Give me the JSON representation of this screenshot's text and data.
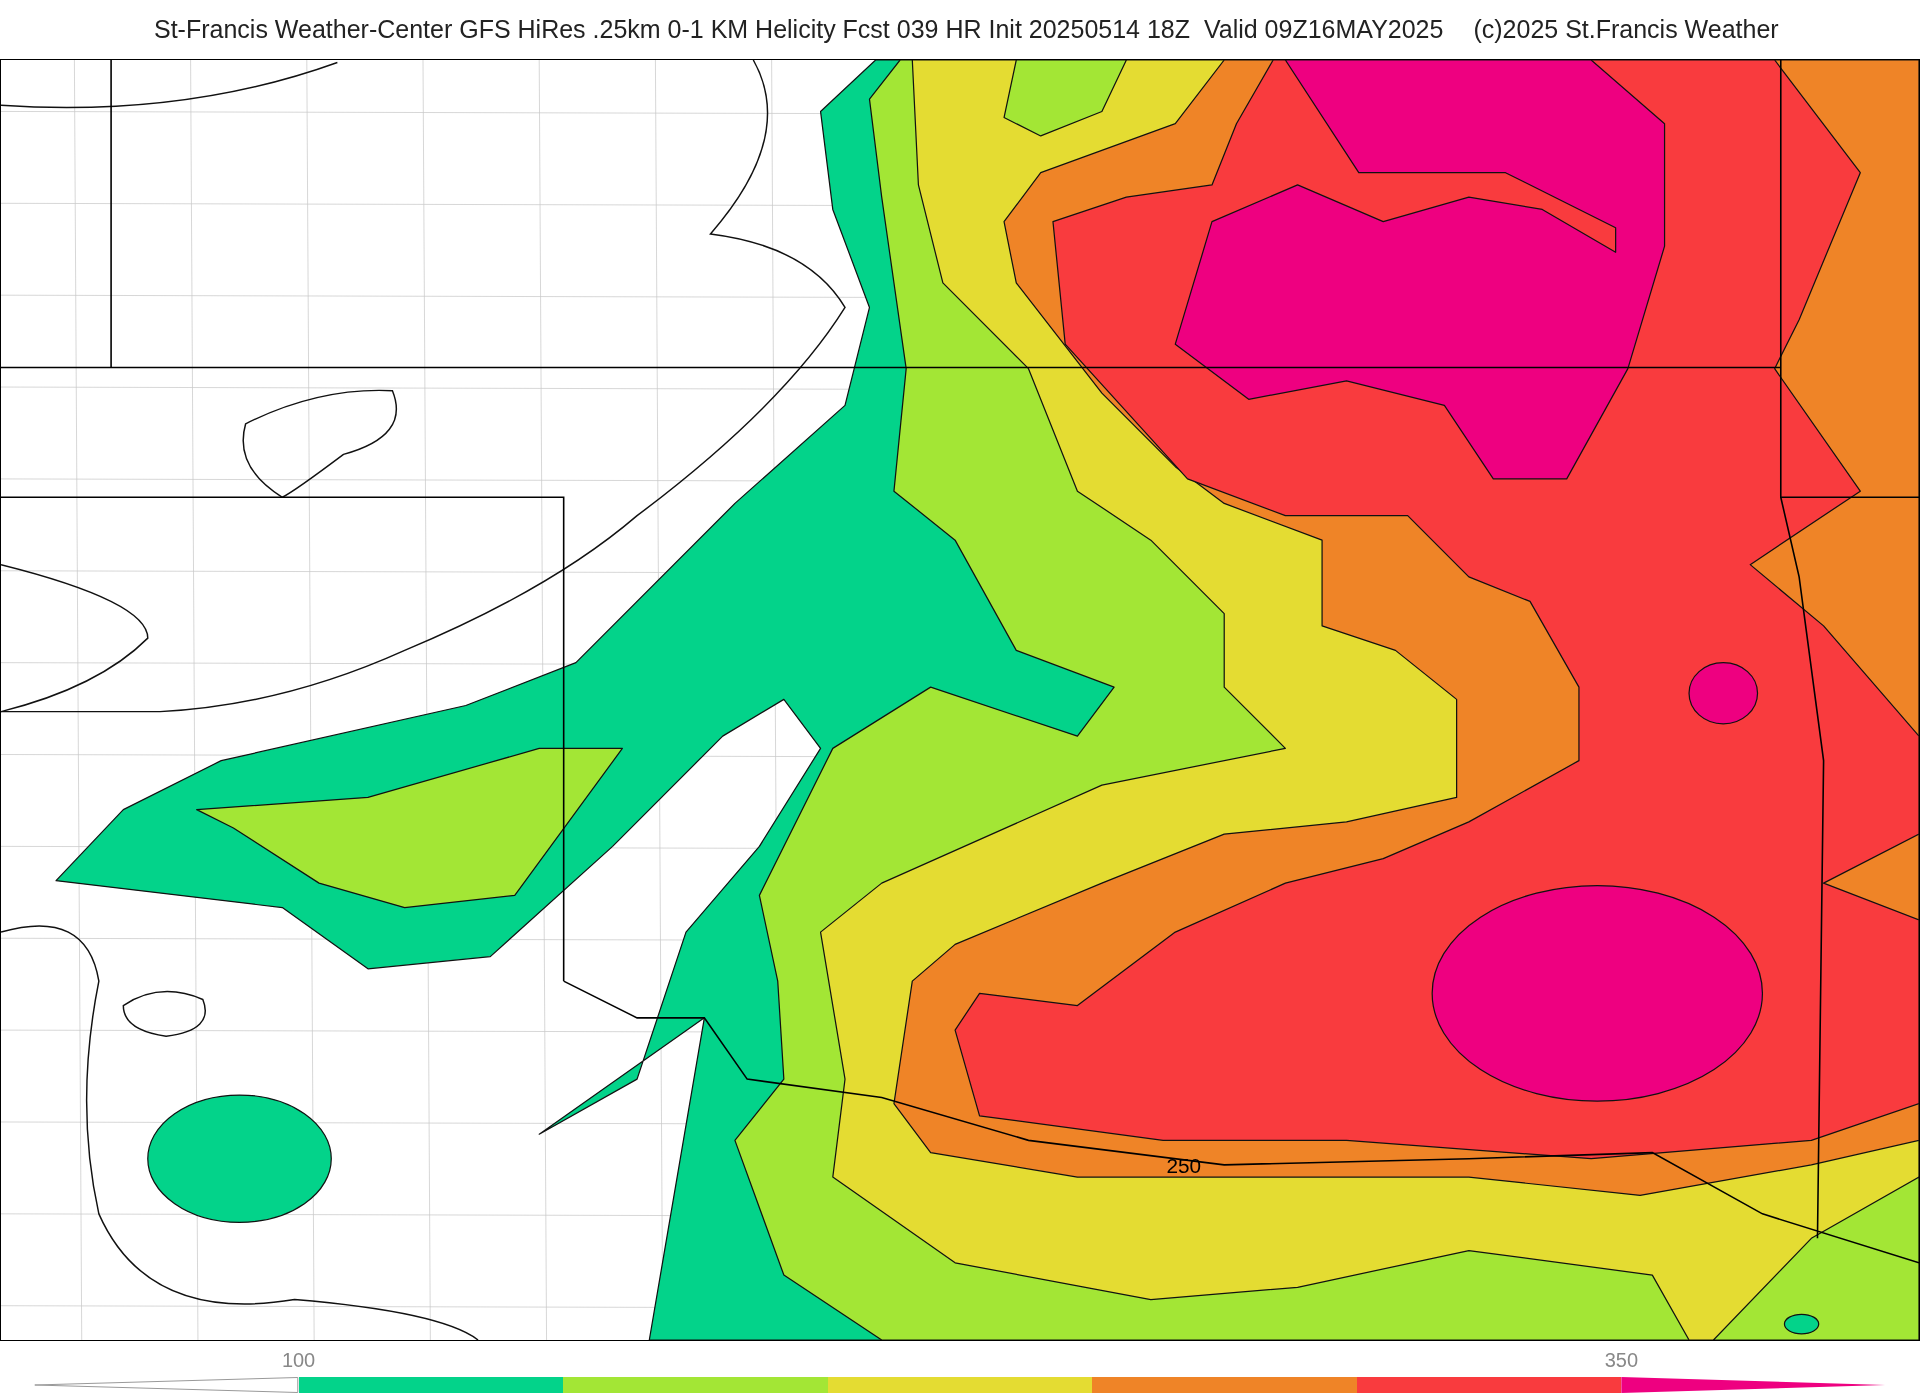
{
  "header": {
    "title": "St-Francis Weather-Center GFS HiRes .25km 0-1 KM Helicity Fcst 039 HR Init 20250514 18Z  Valid 09Z16MAY2025",
    "copyright": "(c)2025 St.Francis Weather"
  },
  "map": {
    "contour_label": "250"
  },
  "colorbar": {
    "ticks": [
      "100",
      "350"
    ],
    "segments": [
      {
        "kind": "under"
      },
      {
        "kind": "bar",
        "color": "#03d38a"
      },
      {
        "kind": "bar",
        "color": "#a3e635"
      },
      {
        "kind": "bar",
        "color": "#e4dc32"
      },
      {
        "kind": "bar",
        "color": "#ef8427"
      },
      {
        "kind": "bar",
        "color": "#f93b3e"
      },
      {
        "kind": "over",
        "color": "#ee0080"
      }
    ]
  }
}
